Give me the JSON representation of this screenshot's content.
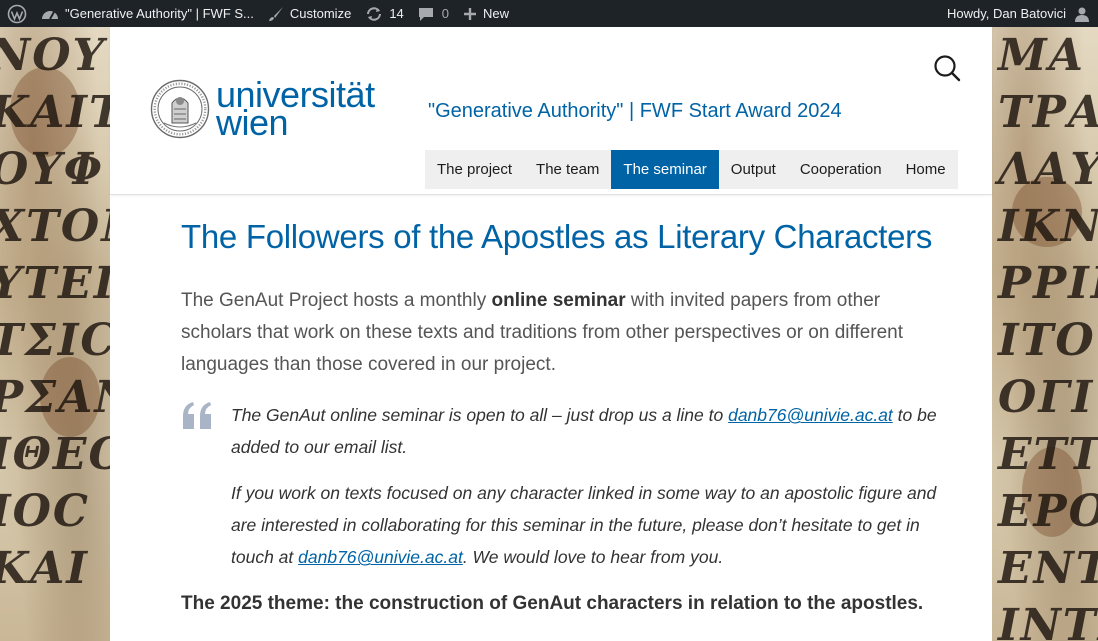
{
  "adminbar": {
    "site_title": "\"Generative Authority\" | FWF S...",
    "customize_label": "Customize",
    "updates_count": "14",
    "comments_count": "0",
    "new_label": "New",
    "greeting": "Howdy, Dan Batovici"
  },
  "logo": {
    "word1": "universität",
    "word2": "wien"
  },
  "site": {
    "title": "\"Generative Authority\" | FWF Start Award 2024"
  },
  "nav": {
    "items": [
      {
        "label": "The project"
      },
      {
        "label": "The team"
      },
      {
        "label": "The seminar"
      },
      {
        "label": "Output"
      },
      {
        "label": "Cooperation"
      },
      {
        "label": "Home"
      }
    ],
    "active": "The seminar"
  },
  "main": {
    "heading": "The Followers of the Apostles as Literary Characters",
    "lead_before": "The GenAut Project hosts a monthly ",
    "lead_strong": "online seminar",
    "lead_after": " with invited papers from other scholars that work on these texts and traditions from other perspectives or on different languages than those covered in our project.",
    "quote1_before": "The GenAut online seminar is open to all – just drop us a line to ",
    "quote1_link": "danb76@univie.ac.at",
    "quote1_after": " to be added to our email list.",
    "quote2_before": "If you work on texts focused on any character linked in some way to an apostolic figure and are interested in collaborating for this seminar in the future, please don’t hesitate to get in touch at ",
    "quote2_link": "danb76@univie.ac.at",
    "quote2_after": ". We would love to hear from you.",
    "theme": "The 2025 theme: the construction of GenAut characters in relation to the apostles."
  },
  "colors": {
    "brand": "#0063a6",
    "adminbar": "#1d2327",
    "nav_bg": "#efefef"
  },
  "icons": [
    "wordpress-icon",
    "dashboard-icon",
    "brush-icon",
    "updates-icon",
    "comment-icon",
    "plus-icon",
    "user-avatar-icon",
    "search-icon",
    "quote-icon",
    "university-seal-icon"
  ]
}
